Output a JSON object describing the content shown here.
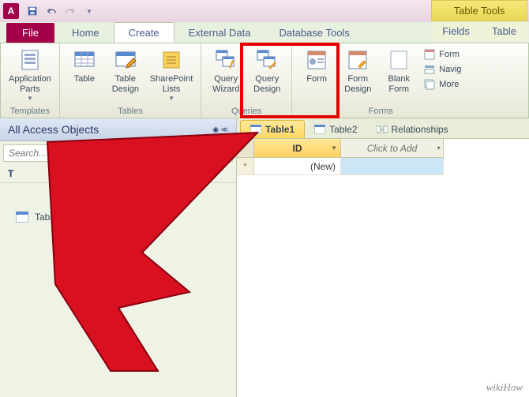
{
  "qat": {
    "app_letter": "A"
  },
  "contextual": {
    "title": "Table Tools",
    "tabs": [
      "Fields",
      "Table"
    ]
  },
  "tabs": {
    "file": "File",
    "items": [
      "Home",
      "Create",
      "External Data",
      "Database Tools"
    ],
    "active_index": 1
  },
  "ribbon": {
    "templates": {
      "label": "Templates",
      "app_parts": "Application\nParts"
    },
    "tables": {
      "label": "Tables",
      "table": "Table",
      "table_design": "Table\nDesign",
      "sharepoint": "SharePoint\nLists"
    },
    "queries": {
      "label": "Queries",
      "wizard": "Query\nWizard",
      "design": "Query\nDesign"
    },
    "forms": {
      "label": "Forms",
      "form": "Form",
      "form_design": "Form\nDesign",
      "blank": "Blank\nForm",
      "wizard": "Form",
      "nav": "Navig",
      "more": "More"
    }
  },
  "nav": {
    "header": "All Access Objects",
    "search_placeholder": "Search...",
    "section": "T",
    "items": [
      "Table"
    ]
  },
  "doctabs": [
    {
      "label": "Table1",
      "type": "table",
      "active": true
    },
    {
      "label": "Table2",
      "type": "table",
      "active": false
    },
    {
      "label": "Relationships",
      "type": "rel",
      "active": false
    }
  ],
  "datasheet": {
    "col_id": "ID",
    "col_add": "Click to Add",
    "new_row": "(New)"
  },
  "watermark": "wikiHow"
}
